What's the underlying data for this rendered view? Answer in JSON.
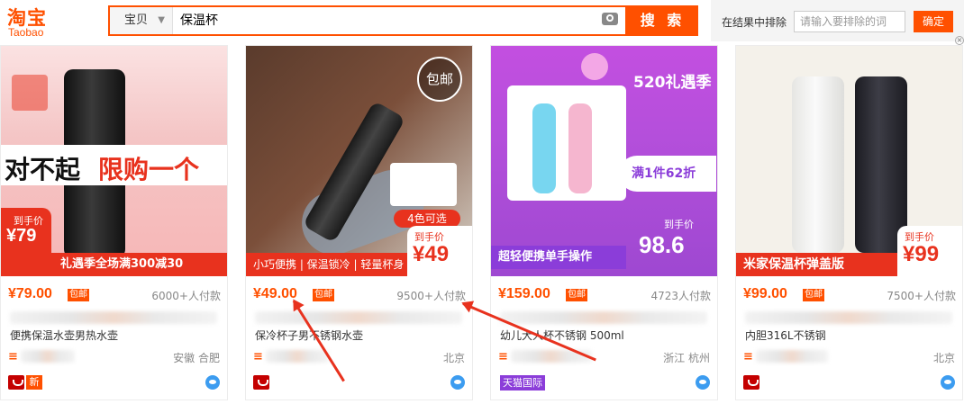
{
  "header": {
    "logo_cn": "淘宝",
    "logo_en": "Taobao",
    "scope": "宝贝",
    "query": "保温杯",
    "search_button": "搜 索",
    "exclude_label": "在结果中排除",
    "exclude_placeholder": "请输入要排除的词",
    "exclude_button": "确定",
    "close": "×"
  },
  "products": [
    {
      "promo_price_label": "到手价",
      "promo_price_value": "¥79",
      "promo_strip": "礼遇季全场满300减30",
      "promo_banner_a": "对不起",
      "promo_banner_b": "限购一个",
      "price": "¥79.00",
      "free_shipping": "包邮",
      "sales": "6000+人付款",
      "title": "便携保温水壶男热水壶",
      "location": "安徽 合肥",
      "tag": "新"
    },
    {
      "promo_price_label": "到手价",
      "promo_price_value": "¥49",
      "promo_strip": "小巧便携 | 保温锁冷 | 轻量杯身",
      "badge": "包邮",
      "colors": "4色可选",
      "price": "¥49.00",
      "free_shipping": "包邮",
      "sales": "9500+人付款",
      "title": "保冷杯子男不锈钢水壶",
      "location": "北京"
    },
    {
      "promo_price_label": "到手价",
      "promo_price_value": "98.6",
      "promo_strip": "超轻便携单手操作",
      "promo_deal": "满1件62折",
      "promo_event": "520礼遇季",
      "price": "¥159.00",
      "free_shipping": "包邮",
      "sales": "4723人付款",
      "title": "幼儿大人杯不锈钢 500ml",
      "location": "浙江 杭州",
      "tag": "天猫国际"
    },
    {
      "promo_price_label": "到手价",
      "promo_price_value": "¥99",
      "promo_strip": "米家保温杯弹盖版",
      "price": "¥99.00",
      "free_shipping": "包邮",
      "sales": "7500+人付款",
      "title": "内胆316L不锈钢",
      "location": "北京"
    }
  ],
  "colors": {
    "accent": "#ff5000",
    "promo_red": "#e8321e",
    "tmall_purple": "#8b3dd9"
  }
}
